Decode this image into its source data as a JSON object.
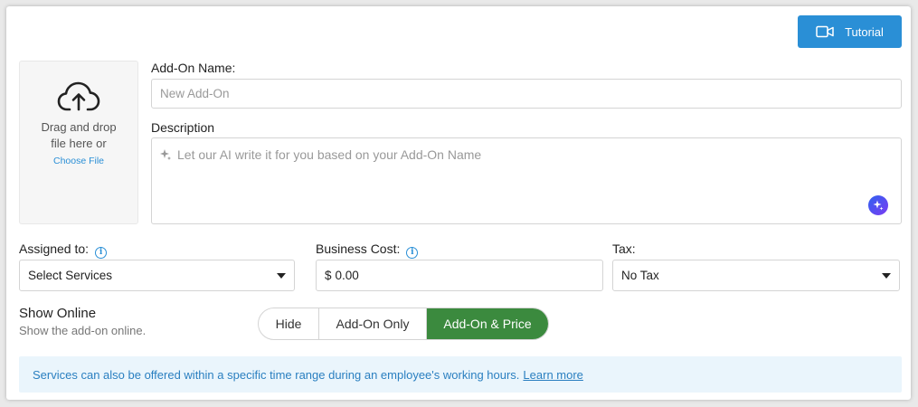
{
  "header": {
    "tutorial_label": "Tutorial"
  },
  "upload": {
    "drag_text": "Drag and drop file here or",
    "choose_label": "Choose File"
  },
  "addon_name": {
    "label": "Add-On Name:",
    "placeholder": "New Add-On",
    "value": ""
  },
  "description": {
    "label": "Description",
    "placeholder": "Let our AI write it for you based on your Add-On Name"
  },
  "assigned": {
    "label": "Assigned to:",
    "value": "Select Services"
  },
  "business_cost": {
    "label": "Business Cost:",
    "currency": "$",
    "value": "0.00"
  },
  "tax": {
    "label": "Tax:",
    "value": "No Tax"
  },
  "show_online": {
    "title": "Show Online",
    "subtitle": "Show the add-on online.",
    "options": [
      "Hide",
      "Add-On Only",
      "Add-On & Price"
    ],
    "selected": "Add-On & Price"
  },
  "banner": {
    "text": "Services can also be offered within a specific time range during an employee's working hours.",
    "link": "Learn more"
  },
  "colors": {
    "accent": "#2a8fd6",
    "selected": "#3b8a3e",
    "banner_bg": "#eaf5fc"
  }
}
